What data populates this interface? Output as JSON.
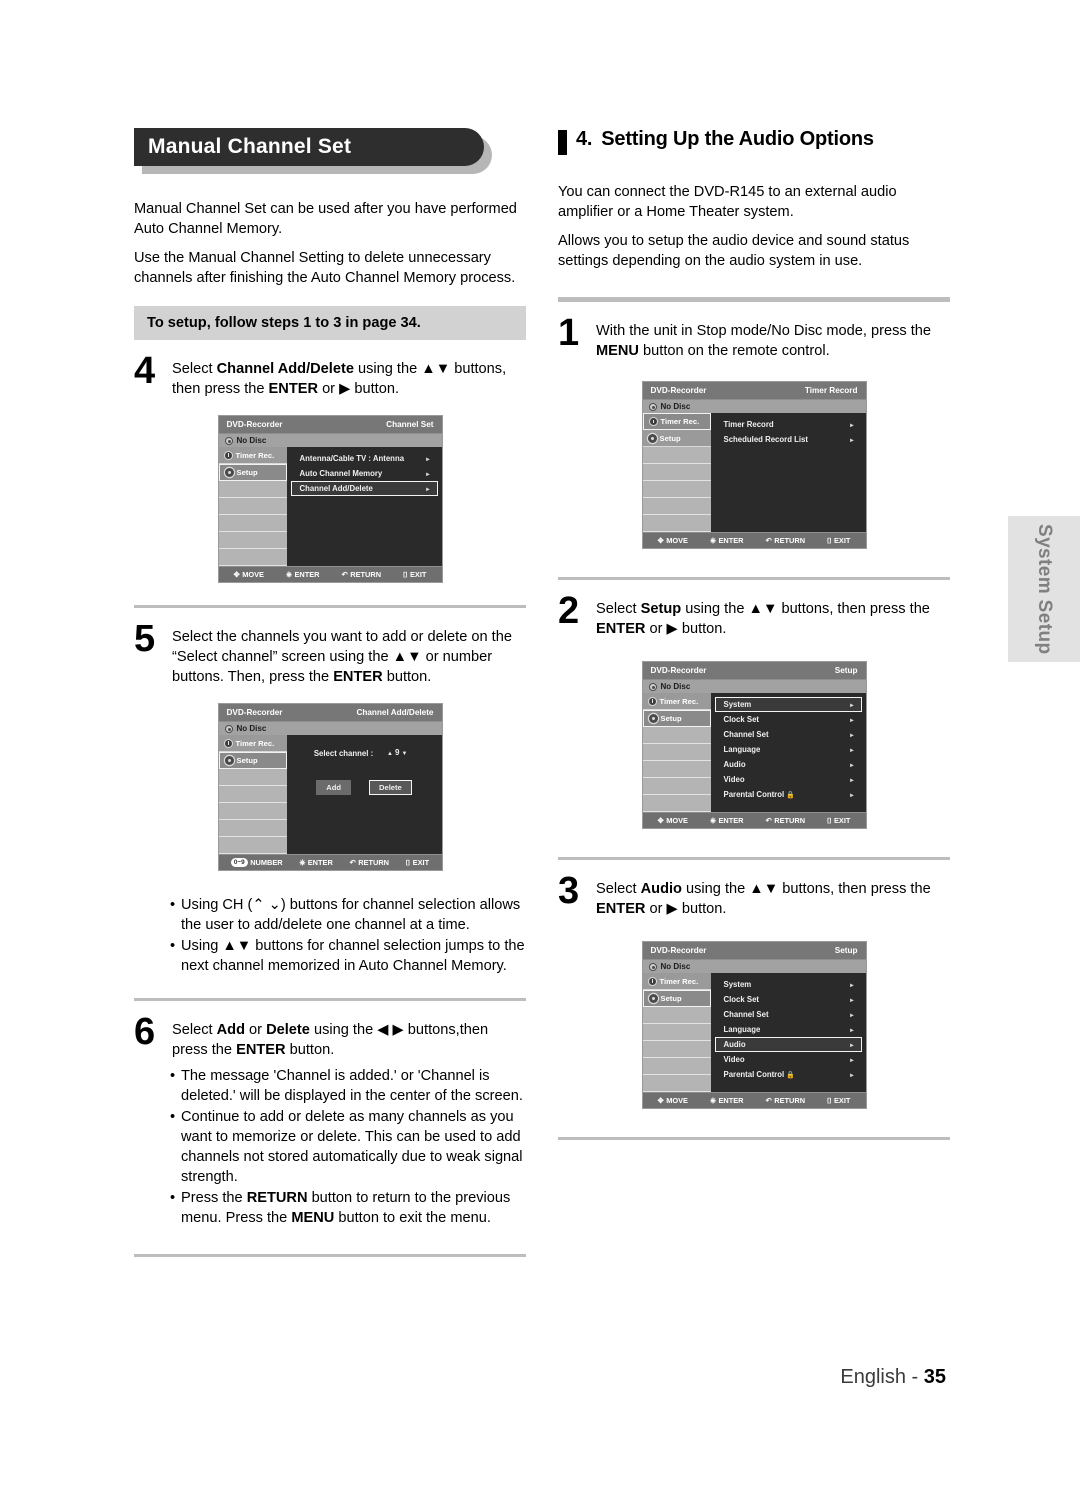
{
  "left": {
    "banner_title": "Manual Channel Set",
    "intro_p1": "Manual Channel Set can be used after you have performed Auto Channel Memory.",
    "intro_p2": "Use the Manual Channel Setting to delete unnecessary channels after finishing the Auto Channel Memory process.",
    "callout": "To setup, follow steps 1 to 3 in page 34.",
    "step4": {
      "num": "4",
      "text_1": "Select ",
      "bold_1": "Channel Add/Delete",
      "text_2": " using the ▲▼ buttons, then press the ",
      "bold_2": "ENTER",
      "text_3": " or ▶ button."
    },
    "step5": {
      "num": "5",
      "text_1": "Select the channels you want to add or delete on the “Select channel” screen using the ▲▼ or number buttons. Then, press the ",
      "bold_1": "ENTER",
      "text_2": " button."
    },
    "bullets_after_5": [
      "Using CH (⌃ ⌄) buttons for channel selection allows the user to add/delete one channel at a time.",
      "Using ▲▼ buttons for channel selection jumps to the next channel memorized in Auto Channel Memory."
    ],
    "step6": {
      "num": "6",
      "text_1": "Select ",
      "bold_1": "Add",
      "text_2": " or ",
      "bold_2": "Delete",
      "text_3": " using the ◀ ▶ buttons,then press the ",
      "bold_3": "ENTER",
      "text_4": " button."
    },
    "bullets_after_6": [
      {
        "part_1": "The message 'Channel is added.' or 'Channel is deleted.' will be displayed in the center of the screen.",
        "bold_1": "",
        "part_2": ""
      },
      {
        "part_1": "Continue to add or delete as many channels as you want to memorize or delete. This can be used to add channels not stored automatically due to weak signal strength.",
        "bold_1": "",
        "part_2": ""
      },
      {
        "part_1": "Press the ",
        "bold_1": "RETURN",
        "part_2": " button to return to the previous menu. Press the ",
        "bold_2": "MENU",
        "part_3": " button to exit the menu."
      }
    ]
  },
  "right": {
    "heading_num": "4.",
    "heading_text": "Setting Up the Audio Options",
    "intro_p1": "You can connect the DVD-R145 to an external audio amplifier or a Home Theater system.",
    "intro_p2": "Allows you to setup the audio device and sound status settings depending on the audio system in use.",
    "step1": {
      "num": "1",
      "text_1": "With the unit in Stop mode/No Disc mode, press the ",
      "bold_1": "MENU",
      "text_2": " button on the remote control."
    },
    "step2": {
      "num": "2",
      "text_1": "Select ",
      "bold_1": "Setup",
      "text_2": " using the ▲▼ buttons, then press the ",
      "bold_2": "ENTER",
      "text_3": " or ▶ button."
    },
    "step3": {
      "num": "3",
      "text_1": "Select ",
      "bold_1": "Audio",
      "text_2": " using the ▲▼ buttons, then press the ",
      "bold_2": "ENTER",
      "text_3": " or ▶ button."
    }
  },
  "osd_common": {
    "brand": "DVD-Recorder",
    "disc_label": "No Disc",
    "sidebar": [
      {
        "label": "Timer Rec.",
        "icon": "timer-icon"
      },
      {
        "label": "Setup",
        "icon": "gear-icon"
      }
    ],
    "footer_move": "MOVE",
    "footer_enter": "ENTER",
    "footer_return": "RETURN",
    "footer_exit": "EXIT",
    "footer_number": "NUMBER",
    "number_pill": "0~9",
    "arrow_glyph": "▸",
    "move_icon": "✥",
    "enter_icon": "⎈",
    "return_icon": "↶",
    "exit_icon": "⌷"
  },
  "osd_channel_set": {
    "screen_name": "Channel Set",
    "selected_sidebar": "Setup",
    "rows": [
      {
        "label": "Antenna/Cable TV : Antenna",
        "selected": false
      },
      {
        "label": "Auto Channel Memory",
        "selected": false
      },
      {
        "label": "Channel Add/Delete",
        "selected": true
      }
    ]
  },
  "osd_channel_add_delete": {
    "screen_name": "Channel Add/Delete",
    "selected_sidebar": "Setup",
    "select_channel_label": "Select channel :",
    "channel_value": "9",
    "up_arrow": "▲",
    "down_arrow": "▼",
    "btn_add": "Add",
    "btn_delete": "Delete",
    "selected_button": "Delete"
  },
  "osd_timer_record": {
    "screen_name": "Timer Record",
    "selected_sidebar": "Timer Rec.",
    "rows": [
      {
        "label": "Timer Record",
        "selected": false
      },
      {
        "label": "Scheduled Record List",
        "selected": false
      }
    ]
  },
  "osd_setup_system": {
    "screen_name": "Setup",
    "selected_sidebar": "Setup",
    "rows": [
      {
        "label": "System",
        "selected": true,
        "lock": false
      },
      {
        "label": "Clock Set",
        "selected": false,
        "lock": false
      },
      {
        "label": "Channel Set",
        "selected": false,
        "lock": false
      },
      {
        "label": "Language",
        "selected": false,
        "lock": false
      },
      {
        "label": "Audio",
        "selected": false,
        "lock": false
      },
      {
        "label": "Video",
        "selected": false,
        "lock": false
      },
      {
        "label": "Parental Control",
        "selected": false,
        "lock": true
      }
    ]
  },
  "osd_setup_audio": {
    "screen_name": "Setup",
    "selected_sidebar": "Setup",
    "rows": [
      {
        "label": "System",
        "selected": false,
        "lock": false
      },
      {
        "label": "Clock Set",
        "selected": false,
        "lock": false
      },
      {
        "label": "Channel Set",
        "selected": false,
        "lock": false
      },
      {
        "label": "Language",
        "selected": false,
        "lock": false
      },
      {
        "label": "Audio",
        "selected": true,
        "lock": false
      },
      {
        "label": "Video",
        "selected": false,
        "lock": false
      },
      {
        "label": "Parental Control",
        "selected": false,
        "lock": true
      }
    ]
  },
  "side_tab": {
    "label": "System Setup"
  },
  "footer": {
    "language": "English - ",
    "page": "35"
  }
}
